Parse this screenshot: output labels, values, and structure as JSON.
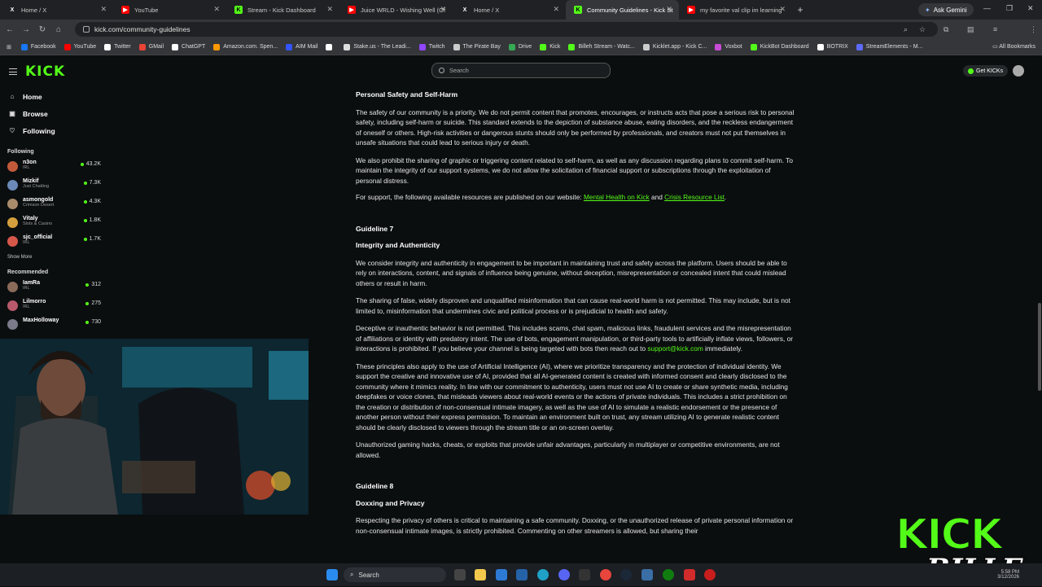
{
  "tabs": [
    {
      "title": "Home / X",
      "icon": "x-icon",
      "color": "#ffffff"
    },
    {
      "title": "YouTube",
      "icon": "youtube-icon",
      "color": "#ff0000"
    },
    {
      "title": "Stream - Kick Dashboard",
      "icon": "kick-icon",
      "color": "#53fc18"
    },
    {
      "title": "Juice WRLD - Wishing Well (Of",
      "icon": "youtube-icon",
      "color": "#ff0000"
    },
    {
      "title": "Home / X",
      "icon": "x-icon",
      "color": "#ffffff"
    },
    {
      "title": "Community Guidelines - Kick St",
      "icon": "kick-icon",
      "color": "#53fc18"
    },
    {
      "title": "my favorite val clip im learning",
      "icon": "youtube-icon",
      "color": "#ff0000"
    }
  ],
  "gemini_label": "Ask Gemini",
  "url": "kick.com/community-guidelines",
  "bookmarks": [
    {
      "label": "Facebook",
      "color": "#1877f2"
    },
    {
      "label": "YouTube",
      "color": "#ff0000"
    },
    {
      "label": "Twitter",
      "color": "#ffffff"
    },
    {
      "label": "GMail",
      "color": "#ea4335"
    },
    {
      "label": "ChatGPT",
      "color": "#ffffff"
    },
    {
      "label": "Amazon.com. Spen...",
      "color": "#ff9900"
    },
    {
      "label": "AIM Mail",
      "color": "#3355ff"
    },
    {
      "label": "",
      "color": "#ffffff"
    },
    {
      "label": "Stake.us - The Leadi...",
      "color": "#dddddd"
    },
    {
      "label": "Twitch",
      "color": "#9146ff"
    },
    {
      "label": "The Pirate Bay",
      "color": "#cccccc"
    },
    {
      "label": "Drive",
      "color": "#34a853"
    },
    {
      "label": "Kick",
      "color": "#53fc18"
    },
    {
      "label": "Billeh Stream - Watc...",
      "color": "#53fc18"
    },
    {
      "label": "Kicklet.app - Kick C...",
      "color": "#cccccc"
    },
    {
      "label": "Voxbot",
      "color": "#c84bd6"
    },
    {
      "label": "KickBot Dashboard",
      "color": "#53fc18"
    },
    {
      "label": "BOTRIX",
      "color": "#ffffff"
    },
    {
      "label": "StreamElements - M...",
      "color": "#5b6bff"
    }
  ],
  "all_bookmarks": "All Bookmarks",
  "kick": {
    "logo": "KICK",
    "search_placeholder": "Search",
    "get_kicks": "Get KICKs"
  },
  "sidebar": {
    "nav": [
      {
        "label": "Home",
        "icon": "home-icon",
        "glyph": "⌂"
      },
      {
        "label": "Browse",
        "icon": "browse-icon",
        "glyph": "▣"
      },
      {
        "label": "Following",
        "icon": "heart-icon",
        "glyph": "♡"
      }
    ],
    "following_heading": "Following",
    "following": [
      {
        "name": "n3on",
        "category": "IRL",
        "viewers": "43.2K",
        "avatar": "#c25a3a"
      },
      {
        "name": "Mizkif",
        "category": "Just Chatting",
        "viewers": "7.3K",
        "avatar": "#6b8ab8"
      },
      {
        "name": "asmongold",
        "category": "Crimson Desert",
        "viewers": "4.3K",
        "avatar": "#a88b6b"
      },
      {
        "name": "Vitaly",
        "category": "Slots & Casino",
        "viewers": "1.8K",
        "avatar": "#d4a03d"
      },
      {
        "name": "sjc_official",
        "category": "IRL",
        "viewers": "1.7K",
        "avatar": "#d6584b"
      }
    ],
    "show_more": "Show More",
    "recommended_heading": "Recommended",
    "recommended": [
      {
        "name": "IamRa",
        "category": "IRL",
        "viewers": "312",
        "avatar": "#8a6b5a"
      },
      {
        "name": "Lilmorro",
        "category": "IRL",
        "viewers": "275",
        "avatar": "#b85a6b"
      },
      {
        "name": "MaxHolloway",
        "category": "",
        "viewers": "730",
        "avatar": "#7a7a8a"
      }
    ]
  },
  "content": {
    "ps_title": "Personal Safety and Self-Harm",
    "ps_p1": "The safety of our community is a priority. We do not permit content that promotes, encourages, or instructs acts that pose a serious risk to personal safety, including self-harm or suicide. This standard extends to the depiction of substance abuse, eating disorders, and the reckless endangerment of oneself or others. High-risk activities or dangerous stunts should only be performed by professionals, and creators must not put themselves in unsafe situations that could lead to serious injury or death.",
    "ps_p2": "We also prohibit the sharing of graphic or triggering content related to self-harm, as well as any discussion regarding plans to commit self-harm. To maintain the integrity of our support systems, we do not allow the solicitation of financial support or subscriptions through the exploitation of personal distress.",
    "ps_p3_prefix": "For support, the following available resources are published on our website: ",
    "ps_link1": "Mental Health on Kick",
    "ps_and": " and ",
    "ps_link2": "Crisis Resource List",
    "ps_period": ".",
    "g7_label": "Guideline 7",
    "g7_title": "Integrity and Authenticity",
    "g7_p1": "We consider integrity and authenticity in engagement to be important in maintaining trust and safety across the platform. Users should be able to rely on interactions, content, and signals of influence being genuine, without deception, misrepresentation or concealed intent that could mislead others or result in harm.",
    "g7_p2": "The sharing of false, widely disproven and unqualified misinformation that can cause real-world harm is not permitted. This may include, but is not limited to, misinformation that undermines civic and political process or is prejudicial to health and safety.",
    "g7_p3": "Deceptive or inauthentic behavior is not permitted. This includes scams, chat spam, malicious links, fraudulent services and the misrepresentation of affiliations or identity with predatory intent. The use of bots, engagement manipulation, or third-party tools to artificially inflate views, followers, or interactions is prohibited. If you believe your channel is being targeted with bots then reach out to ",
    "g7_email": "support@kick.com",
    "g7_p3_suffix": " immediately.",
    "g7_p4": "These principles also apply to the use of Artificial Intelligence (AI), where we prioritize transparency and the protection of individual identity. We support the creative and innovative use of AI, provided that all AI-generated content is created with informed consent and clearly disclosed to the community where it mimics reality. In line with our commitment to authenticity, users must not use AI to create or share synthetic media, including deepfakes or voice clones, that misleads viewers about real-world events or the actions of private individuals. This includes a strict prohibition on the creation or distribution of non-consensual intimate imagery, as well as the use of AI to simulate a realistic endorsement or the presence of another person without their express permission. To maintain an environment built on trust, any stream utilizing AI to generate realistic content should be clearly disclosed to viewers through the stream title or an on-screen overlay.",
    "g7_p5": "Unauthorized gaming hacks, cheats, or exploits that provide unfair advantages, particularly in multiplayer or competitive environments, are not allowed.",
    "g8_label": "Guideline 8",
    "g8_title": "Doxxing and Privacy",
    "g8_p1": "Respecting the privacy of others is critical to maintaining a safe community. Doxxing, or the unauthorized release of private personal information or non-consensual intimate images, is strictly prohibited. Commenting on other streamers is allowed, but sharing their"
  },
  "watermark": {
    "line1": "KICK",
    "line2": "BILLEH"
  },
  "taskbar": {
    "search": "Search",
    "clock_time": "5:58 PM",
    "clock_date": "3/12/2026"
  }
}
